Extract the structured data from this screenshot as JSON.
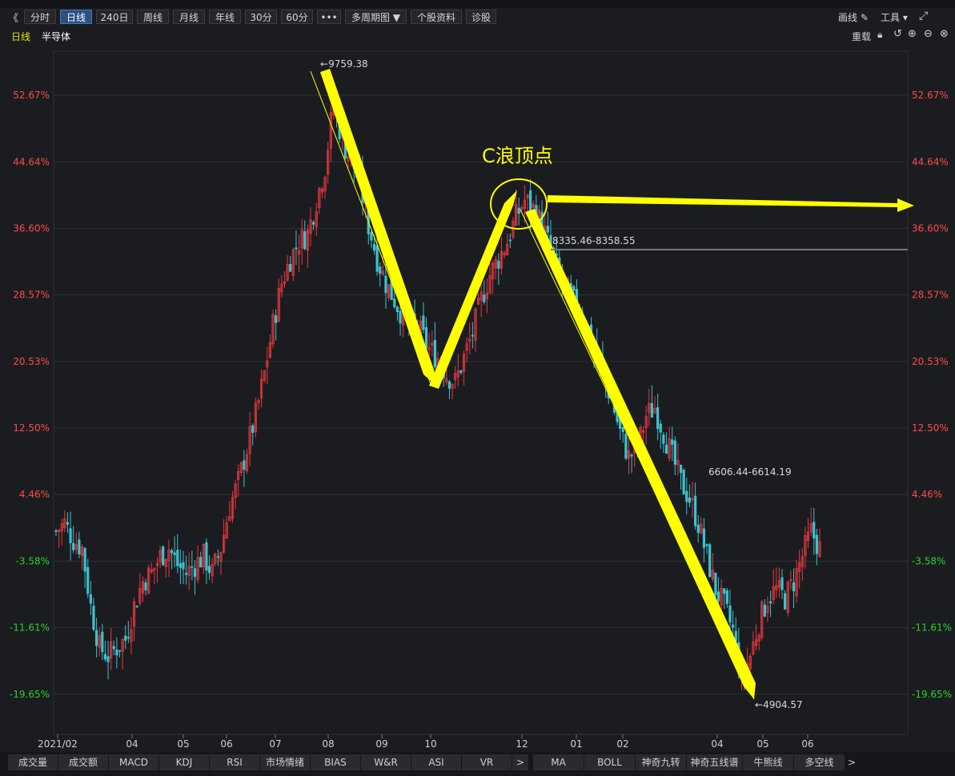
{
  "toolbar": {
    "nav_back": "《",
    "buttons": [
      "分时",
      "日线",
      "240日",
      "周线",
      "月线",
      "年线",
      "30分",
      "60分",
      "•••",
      "多周期图 ▼",
      "个股资料",
      "诊股"
    ],
    "active": "日线",
    "right": {
      "draw": "画线",
      "tools": "工具 ▾"
    }
  },
  "subheader": {
    "period": "日线",
    "name": "半导体",
    "reset": "重载"
  },
  "chart_data": {
    "type": "candlestick",
    "title": "",
    "y_axis_unit": "percent",
    "y_ticks": [
      "52.67%",
      "44.64%",
      "36.60%",
      "28.57%",
      "20.53%",
      "12.50%",
      "4.46%",
      "-3.58%",
      "-11.61%",
      "-19.65%"
    ],
    "y_tick_values": [
      52.67,
      44.64,
      36.6,
      28.57,
      20.53,
      12.5,
      4.46,
      -3.58,
      -11.61,
      -19.65
    ],
    "x_ticks": [
      "2021/02",
      "04",
      "05",
      "06",
      "07",
      "08",
      "09",
      "10",
      "12",
      "01",
      "02",
      "04",
      "05",
      "06"
    ],
    "ylim": [
      -24.5,
      58
    ],
    "approx_path_pct": [
      [
        0,
        0
      ],
      [
        3,
        1
      ],
      [
        6,
        -1
      ],
      [
        9,
        -2
      ],
      [
        12,
        -9
      ],
      [
        15,
        -14
      ],
      [
        18,
        -15
      ],
      [
        21,
        -14
      ],
      [
        24,
        -13
      ],
      [
        27,
        -9
      ],
      [
        30,
        -6
      ],
      [
        33,
        -5
      ],
      [
        36,
        -3
      ],
      [
        39,
        -2
      ],
      [
        42,
        -4
      ],
      [
        45,
        -5
      ],
      [
        48,
        -4
      ],
      [
        51,
        -3
      ],
      [
        54,
        -5
      ],
      [
        57,
        -2
      ],
      [
        60,
        3
      ],
      [
        63,
        6
      ],
      [
        66,
        10
      ],
      [
        69,
        14
      ],
      [
        72,
        19
      ],
      [
        75,
        25
      ],
      [
        78,
        30
      ],
      [
        81,
        33
      ],
      [
        84,
        35
      ],
      [
        87,
        36
      ],
      [
        90,
        40
      ],
      [
        93,
        44
      ],
      [
        96,
        52
      ],
      [
        99,
        47
      ],
      [
        102,
        45
      ],
      [
        105,
        42
      ],
      [
        108,
        37
      ],
      [
        111,
        33
      ],
      [
        114,
        30
      ],
      [
        117,
        28
      ],
      [
        120,
        26
      ],
      [
        123,
        25
      ],
      [
        126,
        24
      ],
      [
        129,
        22
      ],
      [
        132,
        21
      ],
      [
        135,
        19
      ],
      [
        138,
        18
      ],
      [
        141,
        21
      ],
      [
        144,
        24
      ],
      [
        147,
        28
      ],
      [
        150,
        31
      ],
      [
        153,
        33
      ],
      [
        156,
        35
      ],
      [
        159,
        38
      ],
      [
        162,
        40
      ],
      [
        165,
        39
      ],
      [
        168,
        37
      ],
      [
        171,
        34
      ],
      [
        174,
        31
      ],
      [
        177,
        29
      ],
      [
        180,
        27
      ],
      [
        183,
        25
      ],
      [
        186,
        22
      ],
      [
        189,
        19
      ],
      [
        192,
        16
      ],
      [
        195,
        12
      ],
      [
        198,
        9
      ],
      [
        201,
        10
      ],
      [
        204,
        14
      ],
      [
        207,
        15
      ],
      [
        210,
        12
      ],
      [
        213,
        9
      ],
      [
        216,
        6
      ],
      [
        219,
        4
      ],
      [
        222,
        1
      ],
      [
        225,
        -3
      ],
      [
        228,
        -7
      ],
      [
        231,
        -9
      ],
      [
        234,
        -12
      ],
      [
        237,
        -18
      ],
      [
        240,
        -15
      ],
      [
        243,
        -11
      ],
      [
        246,
        -8
      ],
      [
        249,
        -7
      ],
      [
        252,
        -8
      ],
      [
        255,
        -6
      ],
      [
        258,
        -3
      ],
      [
        261,
        0
      ],
      [
        264,
        -2
      ]
    ],
    "annotations": {
      "high": "9759.38",
      "low": "4904.57",
      "c_wave_label": "C浪顶点",
      "range_1": "8335.46-8358.55",
      "range_2": "6606.44-6614.19"
    },
    "colors": {
      "up": "#e8393f",
      "down": "#3bc3d0",
      "axis_pos": "#ff4a4a",
      "axis_neg": "#28d22a",
      "grid": "#2e3036",
      "annot": "#ffff00"
    }
  },
  "bottom_tabs": [
    "成交量",
    "成交额",
    "MACD",
    "KDJ",
    "RSI",
    "市场情绪",
    "BIAS",
    "W&R",
    "ASI",
    "VR",
    "MA",
    "BOLL",
    "神奇九转",
    "神奇五线谱",
    "牛熊线",
    "多空线"
  ]
}
